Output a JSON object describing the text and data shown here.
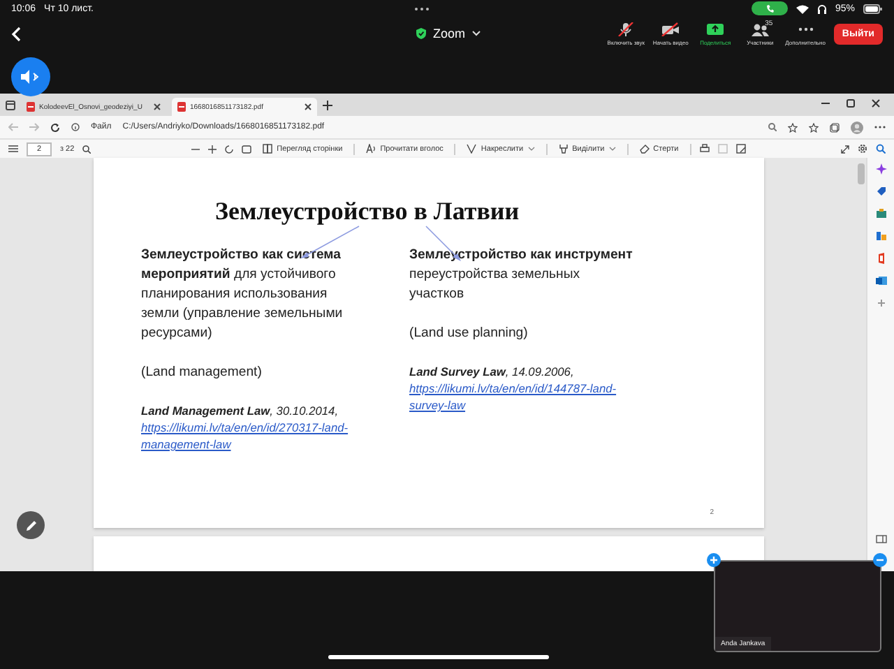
{
  "status_bar": {
    "time": "10:06",
    "date": "Чт 10 лист.",
    "battery": "95%"
  },
  "zoom_bar": {
    "title": "Zoom",
    "controls": [
      {
        "kind": "mic_off",
        "label": "Включить звук"
      },
      {
        "kind": "video_off",
        "label": "Начать видео"
      },
      {
        "kind": "share",
        "label": "Поделиться"
      },
      {
        "kind": "participants",
        "label": "Участники",
        "count": "35"
      },
      {
        "kind": "more",
        "label": "Дополнительно"
      }
    ],
    "leave_button": "Выйти"
  },
  "browser": {
    "tabs": [
      {
        "title": "KolodeevEl_Osnovi_geodeziyi_U",
        "selected": false
      },
      {
        "title": "1668016851173182.pdf",
        "selected": true
      }
    ],
    "address": {
      "scheme": "Файл",
      "url": "C:/Users/Andriyko/Downloads/1668016851173182.pdf"
    },
    "pdf_toolbar": {
      "page": "2",
      "page_count": "з 22",
      "actions": [
        {
          "kind": "page_view",
          "label": "Перегляд сторінки"
        },
        {
          "kind": "read_aloud",
          "label": "Прочитати вголос"
        },
        {
          "kind": "draw",
          "label": "Накреслити"
        },
        {
          "kind": "highlight",
          "label": "Виділити"
        },
        {
          "kind": "erase",
          "label": "Стерти"
        }
      ]
    }
  },
  "document": {
    "pages": [
      {
        "title": "Землеустройство в Латвии",
        "columns": [
          {
            "text": "**Землеустройство как система мероприятий** для устойчивого планирования использования земли (управление земельными ресурсами)",
            "note": "(Land management)",
            "law": "**Land Management Law**, 30.10.2014,",
            "link": "https://likumi.lv/ta/en/en/id/270317-land-management-law"
          },
          {
            "text": "**Землеустройство как инструмент** переустройства земельных участков",
            "note": "(Land use planning)",
            "law": "**Land Survey Law**, 14.09.2006,",
            "link": "https://likumi.lv/ta/en/en/id/144787-land-survey-law"
          }
        ],
        "page_number": "2"
      },
      {
        "kind": "blank"
      }
    ]
  },
  "video_tile": {
    "name": "Anda Jankava"
  }
}
